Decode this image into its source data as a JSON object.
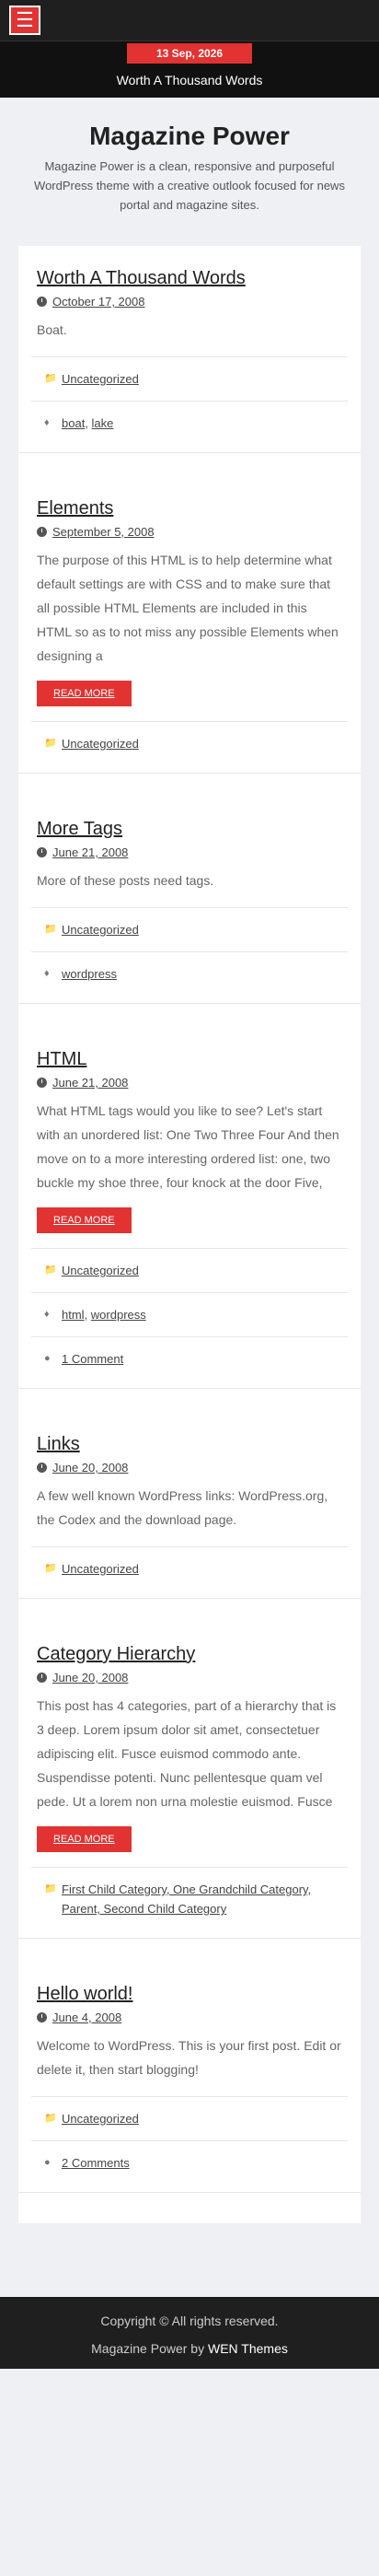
{
  "topbar": {
    "menu_icon": "hamburger-icon"
  },
  "newsbar": {
    "date": "13 Sep, 2026",
    "headline": "Worth A Thousand Words"
  },
  "site": {
    "title": "Magazine Power",
    "description": "Magazine Power is a clean, responsive and purposeful WordPress theme with a creative outlook focused for news portal and magazine sites."
  },
  "posts": [
    {
      "title": "Worth A Thousand Words",
      "date": "October 17, 2008",
      "excerpt": "Boat.",
      "read_more": null,
      "categories": "Uncategorized",
      "tags": [
        "boat",
        "lake"
      ],
      "comments": null
    },
    {
      "title": "Elements",
      "date": "September 5, 2008",
      "excerpt": "The purpose of this HTML is to help determine what default settings are with CSS and to make sure that all possible HTML Elements are included in this HTML so as to not miss any possible Elements when designing a",
      "read_more": "READ MORE",
      "categories": "Uncategorized",
      "tags": null,
      "comments": null
    },
    {
      "title": "More Tags",
      "date": "June 21, 2008",
      "excerpt": "More of these posts need tags.",
      "read_more": null,
      "categories": "Uncategorized",
      "tags": [
        "wordpress"
      ],
      "comments": null
    },
    {
      "title": "HTML",
      "date": "June 21, 2008",
      "excerpt": "What HTML tags would you like to see? Let's start with an unordered list: One Two Three Four And then move on to a more interesting ordered list: one, two buckle my shoe three, four knock at the door Five,",
      "read_more": "READ MORE",
      "categories": "Uncategorized",
      "tags": [
        "html",
        "wordpress"
      ],
      "comments": "1 Comment"
    },
    {
      "title": "Links",
      "date": "June 20, 2008",
      "excerpt": "A few well known WordPress links: WordPress.org, the Codex and the download page.",
      "read_more": null,
      "categories": "Uncategorized",
      "tags": null,
      "comments": null
    },
    {
      "title": "Category Hierarchy",
      "date": "June 20, 2008",
      "excerpt": "This post has 4 categories, part of a hierarchy that is 3 deep. Lorem ipsum dolor sit amet, consectetuer adipiscing elit. Fusce euismod commodo ante. Suspendisse potenti. Nunc pellentesque quam vel pede. Ut a lorem non urna molestie euismod. Fusce",
      "read_more": "READ MORE",
      "categories": "First Child Category, One Grandchild Category, Parent, Second Child Category",
      "tags": null,
      "comments": null
    },
    {
      "title": "Hello world!",
      "date": "June 4, 2008",
      "excerpt": "Welcome to WordPress. This is your first post. Edit or delete it, then start blogging!",
      "read_more": null,
      "categories": "Uncategorized",
      "tags": null,
      "comments": "2 Comments"
    }
  ],
  "footer": {
    "copyright": "Copyright © All rights reserved.",
    "credit_prefix": "Magazine Power by ",
    "credit_link": "WEN Themes"
  },
  "colors": {
    "accent": "#e23232",
    "dark": "#1f1f1f"
  }
}
